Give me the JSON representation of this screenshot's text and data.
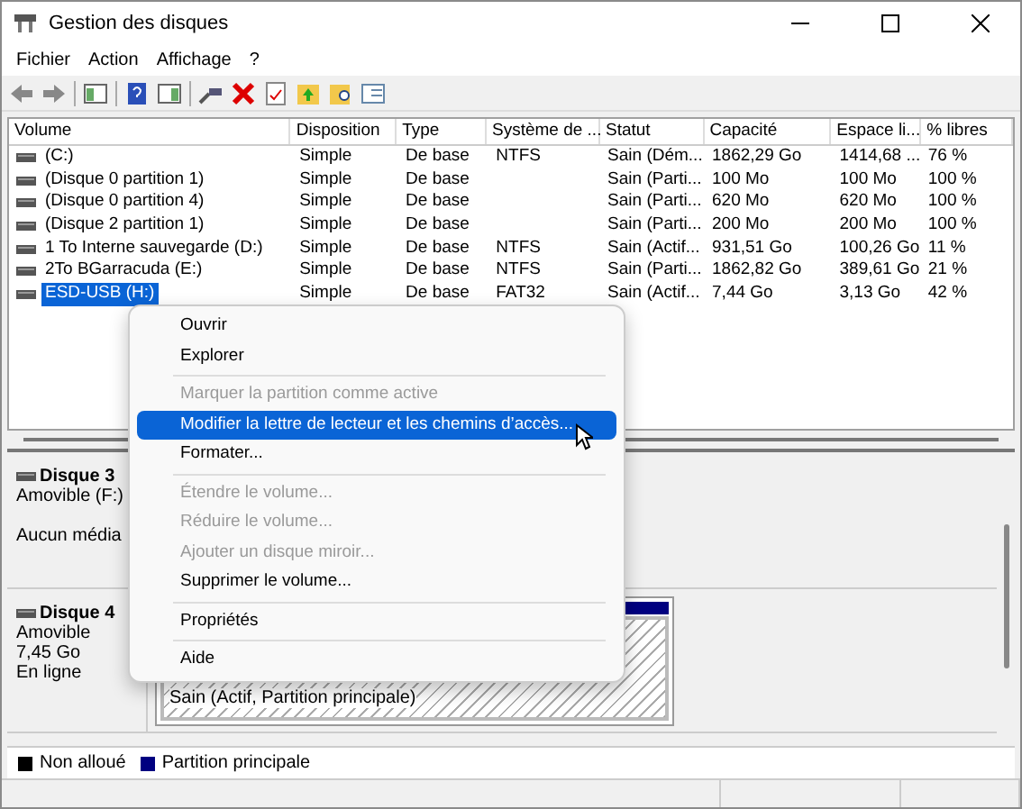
{
  "window": {
    "title": "Gestion des disques"
  },
  "menu": [
    "Fichier",
    "Action",
    "Affichage",
    "?"
  ],
  "table": {
    "columns": [
      "Volume",
      "Disposition",
      "Type",
      "Système de ...",
      "Statut",
      "Capacité",
      "Espace li...",
      "% libres"
    ],
    "rows": [
      {
        "selected": false,
        "cells": [
          "(C:)",
          "Simple",
          "De base",
          "NTFS",
          "Sain (Dém...",
          "1862,29 Go",
          "1414,68 ...",
          "76 %"
        ]
      },
      {
        "selected": false,
        "cells": [
          "(Disque 0 partition 1)",
          "Simple",
          "De base",
          "",
          "Sain (Parti...",
          "100 Mo",
          "100 Mo",
          "100 %"
        ]
      },
      {
        "selected": false,
        "cells": [
          "(Disque 0 partition 4)",
          "Simple",
          "De base",
          "",
          "Sain (Parti...",
          "620 Mo",
          "620 Mo",
          "100 %"
        ]
      },
      {
        "selected": false,
        "cells": [
          "(Disque 2 partition 1)",
          "Simple",
          "De base",
          "",
          "Sain (Parti...",
          "200 Mo",
          "200 Mo",
          "100 %"
        ]
      },
      {
        "selected": false,
        "cells": [
          "1 To Interne sauvegarde (D:)",
          "Simple",
          "De base",
          "NTFS",
          "Sain (Actif...",
          "931,51 Go",
          "100,26 Go",
          "11 %"
        ]
      },
      {
        "selected": false,
        "cells": [
          "2To BGarracuda (E:)",
          "Simple",
          "De base",
          "NTFS",
          "Sain (Parti...",
          "1862,82 Go",
          "389,61 Go",
          "21 %"
        ]
      },
      {
        "selected": true,
        "cells": [
          "ESD-USB (H:)",
          "Simple",
          "De base",
          "FAT32",
          "Sain (Actif...",
          "7,44 Go",
          "3,13 Go",
          "42 %"
        ]
      }
    ]
  },
  "disks": [
    {
      "name": "Disque 3",
      "lines": [
        "Amovible (F:)"
      ],
      "media": "Aucun média"
    },
    {
      "name": "Disque 4",
      "lines": [
        "Amovible",
        "7,45 Go",
        "En ligne"
      ],
      "partition": {
        "status": "Sain (Actif, Partition principale)"
      }
    }
  ],
  "legend": [
    {
      "label": "Non alloué",
      "color": "#000000"
    },
    {
      "label": "Partition principale",
      "color": "#000080"
    }
  ],
  "context_menu": [
    {
      "kind": "item",
      "label": "Ouvrir",
      "disabled": false,
      "selected": false
    },
    {
      "kind": "item",
      "label": "Explorer",
      "disabled": false,
      "selected": false
    },
    {
      "kind": "separator"
    },
    {
      "kind": "item",
      "label": "Marquer la partition comme active",
      "disabled": true,
      "selected": false
    },
    {
      "kind": "item",
      "label": "Modifier la lettre de lecteur et les chemins d’accès...",
      "disabled": false,
      "selected": true
    },
    {
      "kind": "item",
      "label": "Formater...",
      "disabled": false,
      "selected": false
    },
    {
      "kind": "separator"
    },
    {
      "kind": "item",
      "label": "Étendre le volume...",
      "disabled": true,
      "selected": false
    },
    {
      "kind": "item",
      "label": "Réduire le volume...",
      "disabled": true,
      "selected": false
    },
    {
      "kind": "item",
      "label": "Ajouter un disque miroir...",
      "disabled": true,
      "selected": false
    },
    {
      "kind": "item",
      "label": "Supprimer le volume...",
      "disabled": false,
      "selected": false
    },
    {
      "kind": "separator"
    },
    {
      "kind": "item",
      "label": "Propriétés",
      "disabled": false,
      "selected": false
    },
    {
      "kind": "separator"
    },
    {
      "kind": "item",
      "label": "Aide",
      "disabled": false,
      "selected": false
    }
  ]
}
